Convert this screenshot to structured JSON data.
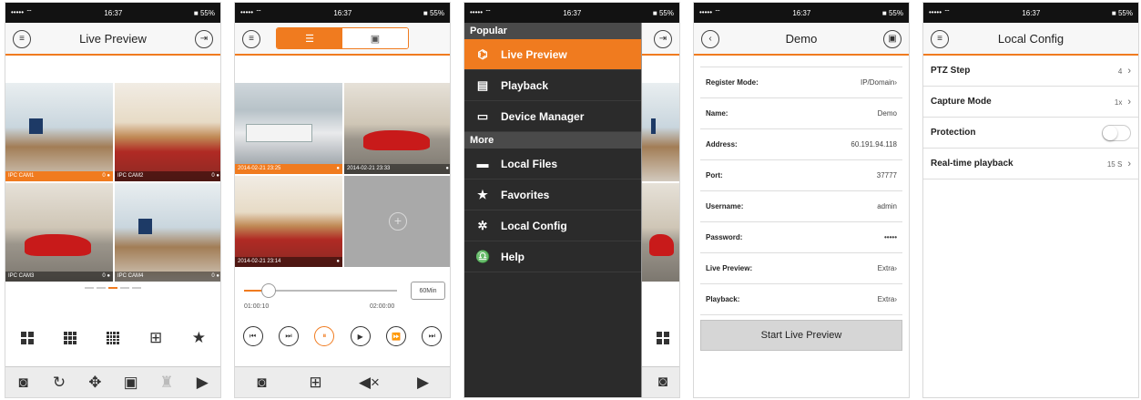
{
  "status": {
    "signal": "•••••  ⌔",
    "time": "16:37",
    "battery": "■ 55%"
  },
  "accent_color": "#f07b1f",
  "screen1": {
    "title": "Live Preview",
    "cams": [
      {
        "name": "IPC CAM1",
        "flags": "0  ●"
      },
      {
        "name": "IPC CAM2",
        "flags": "0  ●"
      },
      {
        "name": "IPC CAM3",
        "flags": "0  ●"
      },
      {
        "name": "IPC CAM4",
        "flags": "0  ●"
      }
    ],
    "layout_icons": [
      "four-split-icon",
      "nine-split-icon",
      "sixteen-split-icon",
      "device-list-icon",
      "favorite-star-icon"
    ],
    "toolbar_icons": [
      "snapshot-icon",
      "ptz-rotate-icon",
      "ptz-move-icon",
      "video-config-icon",
      "alarm-icon",
      "record-icon"
    ]
  },
  "screen2": {
    "tabs": [
      "multi-view-tab",
      "single-view-tab"
    ],
    "cams": [
      {
        "name": "2014-02-21 23:25",
        "flag": "●"
      },
      {
        "name": "2014-02-21 23:33",
        "flag": "●"
      },
      {
        "name": "2014-02-21 23:14",
        "flag": "●"
      }
    ],
    "start_time": "01:00:10",
    "end_time": "02:00:00",
    "speed_label": "60Min",
    "progress": 0.16,
    "controls": [
      "⏮",
      "⏭",
      "⏸",
      "▶",
      "⏩",
      "⏭"
    ],
    "toolbar_icons": [
      "snapshot-icon",
      "device-list-icon",
      "mute-icon",
      "record-icon"
    ]
  },
  "screen3": {
    "sections": [
      {
        "title": "Popular",
        "items": [
          {
            "label": "Live Preview",
            "icon": "camera-icon",
            "glyph": "⌬",
            "active": true
          },
          {
            "label": "Playback",
            "icon": "film-icon",
            "glyph": "▤",
            "active": false
          },
          {
            "label": "Device Manager",
            "icon": "device-icon",
            "glyph": "▭",
            "active": false
          }
        ]
      },
      {
        "title": "More",
        "items": [
          {
            "label": "Local Files",
            "icon": "folder-icon",
            "glyph": "▬",
            "active": false
          },
          {
            "label": "Favorites",
            "icon": "star-icon",
            "glyph": "★",
            "active": false
          },
          {
            "label": "Local Config",
            "icon": "gear-icon",
            "glyph": "✲",
            "active": false
          },
          {
            "label": "Help",
            "icon": "help-icon",
            "glyph": "♎",
            "active": false
          }
        ]
      }
    ]
  },
  "screen4": {
    "title": "Demo",
    "rows": [
      {
        "key": "Register Mode:",
        "value": "IP/Domain›"
      },
      {
        "key": "Name:",
        "value": "Demo"
      },
      {
        "key": "Address:",
        "value": "60.191.94.118"
      },
      {
        "key": "Port:",
        "value": "37777"
      },
      {
        "key": "Username:",
        "value": "admin"
      },
      {
        "key": "Password:",
        "value": "•••••"
      },
      {
        "key": "Live Preview:",
        "value": "Extra›"
      },
      {
        "key": "Playback:",
        "value": "Extra›"
      }
    ],
    "button": "Start Live Preview"
  },
  "screen5": {
    "title": "Local Config",
    "rows": [
      {
        "key": "PTZ Step",
        "value": "4",
        "type": "chevron"
      },
      {
        "key": "Capture Mode",
        "value": "1x",
        "type": "chevron"
      },
      {
        "key": "Protection",
        "value": "",
        "type": "toggle"
      },
      {
        "key": "Real-time playback",
        "value": "15 S",
        "type": "chevron"
      }
    ]
  }
}
